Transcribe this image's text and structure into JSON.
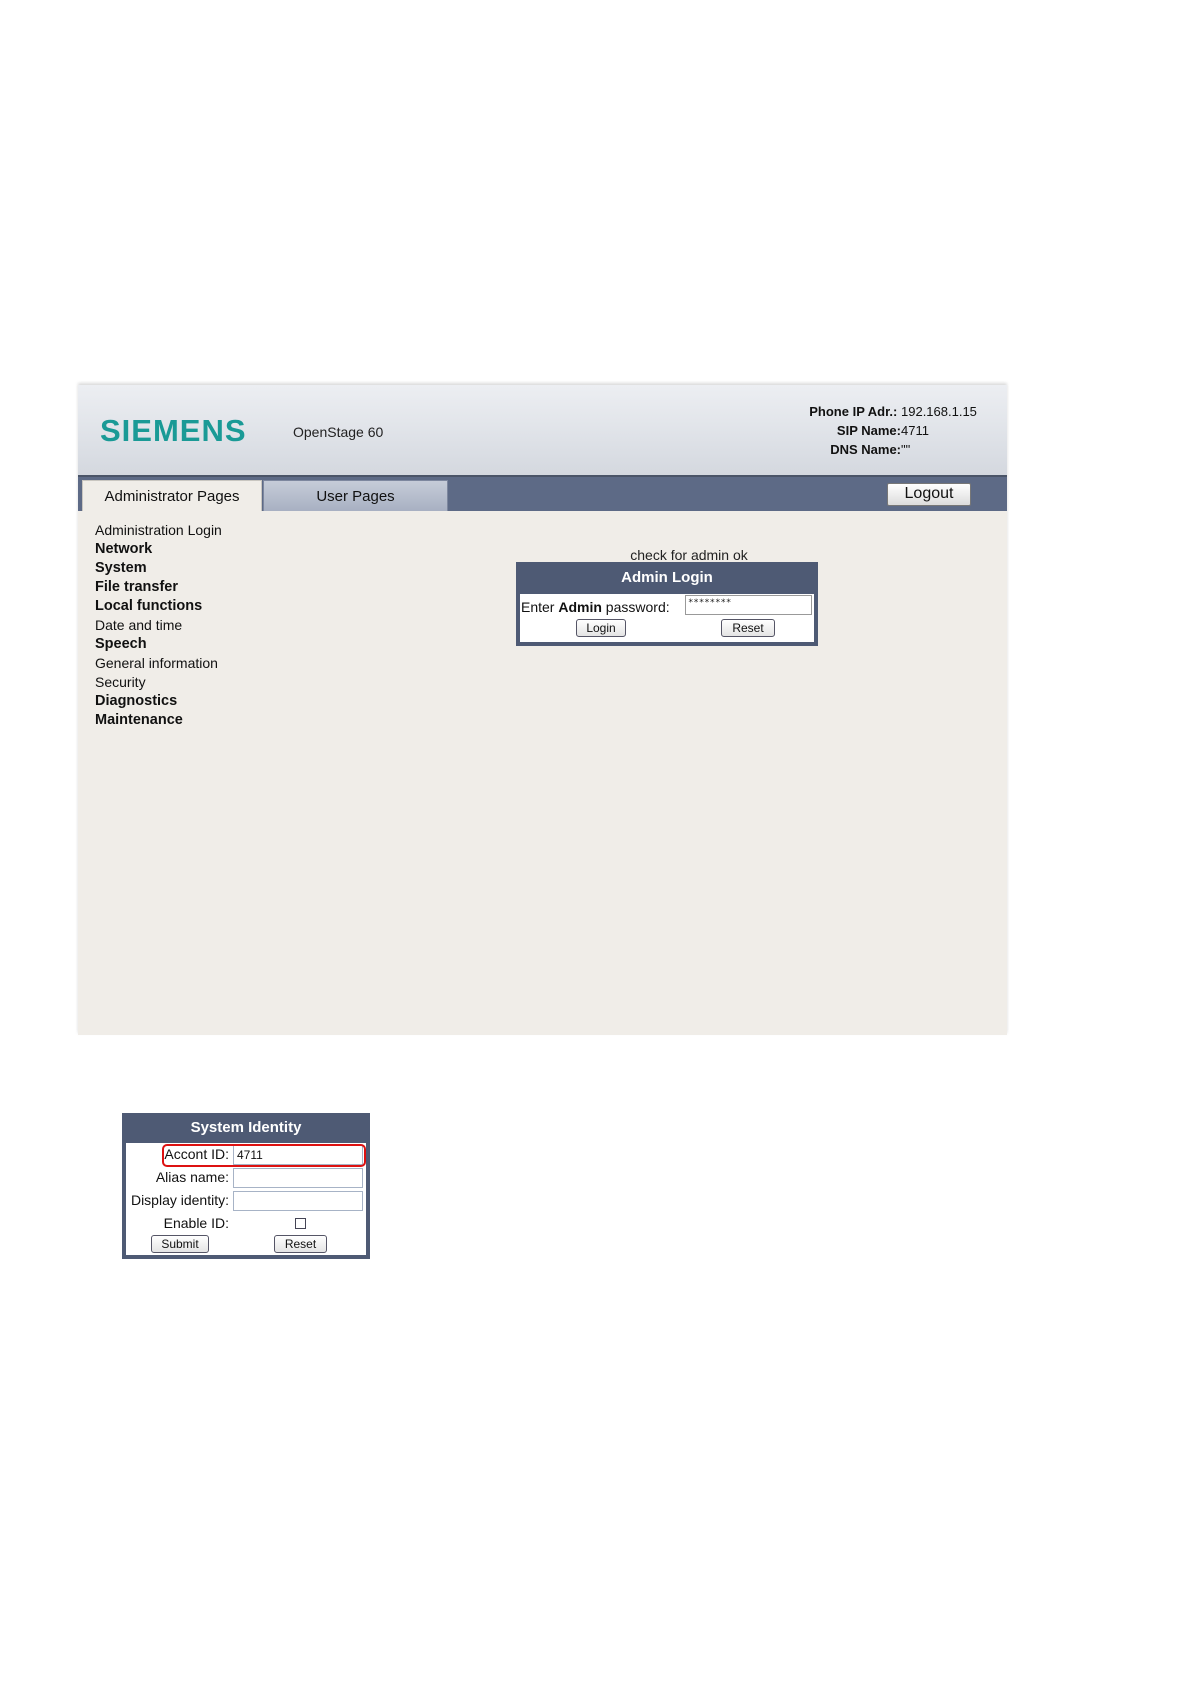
{
  "header": {
    "brand": "SIEMENS",
    "model": "OpenStage 60",
    "phone_ip_label": "Phone IP Adr.:",
    "phone_ip_value": "192.168.1.15",
    "sip_name_label": "SIP Name:",
    "sip_name_value": "4711",
    "dns_name_label": "DNS Name:",
    "dns_name_value": "\"\""
  },
  "tabs": {
    "admin": "Administrator Pages",
    "user": "User Pages",
    "logout": "Logout"
  },
  "nav": {
    "items": [
      {
        "label": "Administration Login"
      },
      {
        "label": "Network"
      },
      {
        "label": "System"
      },
      {
        "label": "File transfer"
      },
      {
        "label": "Local functions"
      },
      {
        "label": "Date and time"
      },
      {
        "label": "Speech"
      },
      {
        "label": "General information"
      },
      {
        "label": "Security"
      },
      {
        "label": "Diagnostics"
      },
      {
        "label": "Maintenance"
      }
    ]
  },
  "login": {
    "status": "check for admin ok",
    "title": "Admin Login",
    "label_prefix": "Enter ",
    "label_bold": "Admin",
    "label_suffix": " password:",
    "password_value": "********",
    "login_button": "Login",
    "reset_button": "Reset"
  },
  "system_identity": {
    "title": "System Identity",
    "account_id_label": "Accont ID:",
    "account_id_value": "4711",
    "alias_label": "Alias name:",
    "alias_value": "",
    "display_label": "Display identity:",
    "display_value": "",
    "enable_label": "Enable ID:",
    "submit_button": "Submit",
    "reset_button": "Reset"
  },
  "colors": {
    "brand": "#1a9a96",
    "panel": "#4e5a74",
    "tabbar": "#5d6a86",
    "content_bg": "#f0ede8",
    "highlight": "#dd1111"
  }
}
